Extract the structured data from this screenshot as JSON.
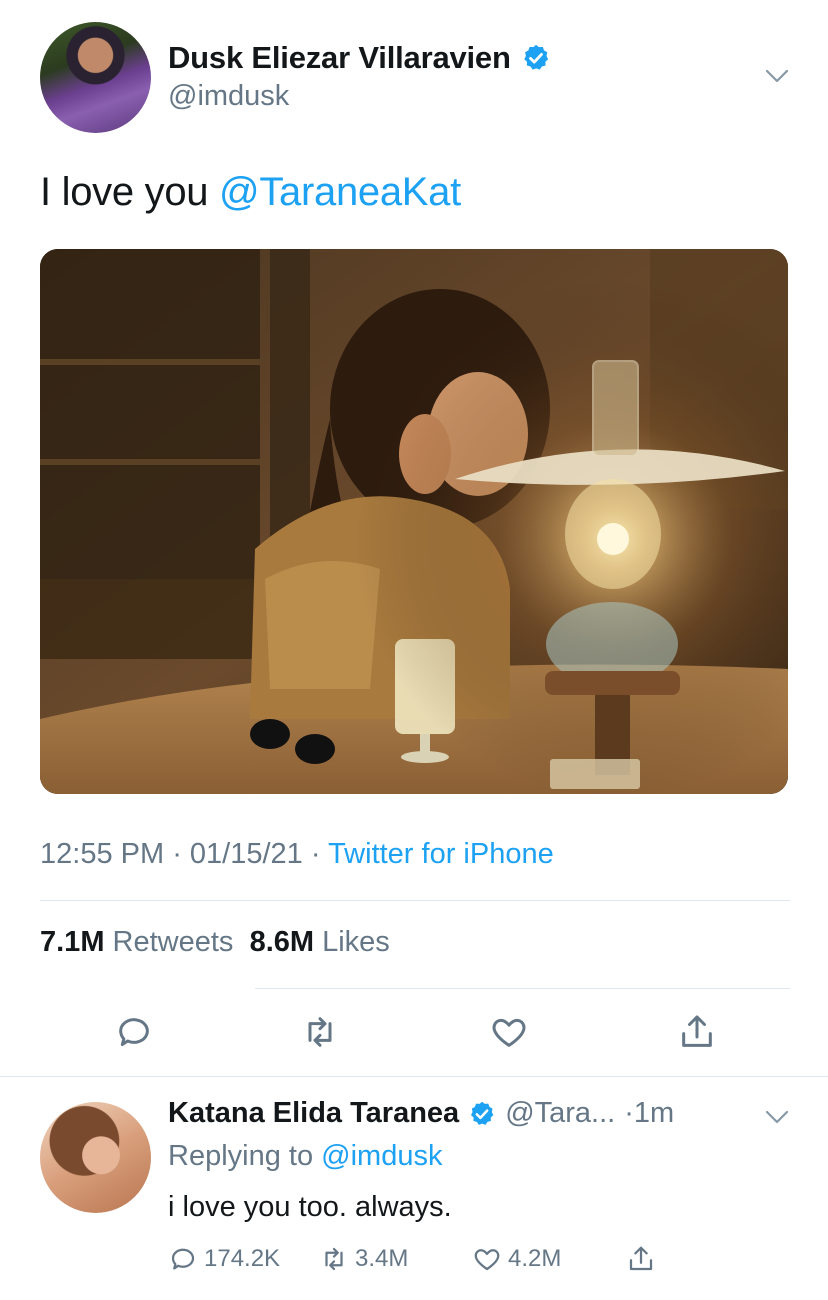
{
  "tweet": {
    "display_name": "Dusk Eliezar Villaravien",
    "handle": "@imdusk",
    "text_prefix": "I love you ",
    "mention": "@TaraneaKat",
    "time": "12:55 PM",
    "separator": " · ",
    "date": "01/15/21",
    "source": "Twitter for iPhone",
    "retweets_count": "7.1M",
    "retweets_label": " Retweets",
    "likes_count": "8.6M",
    "likes_label": " Likes",
    "icons": {
      "verified": "verified-badge-icon",
      "more": "chevron-down-icon",
      "reply": "comment-icon",
      "retweet": "retweet-icon",
      "like": "heart-icon",
      "share": "share-icon"
    }
  },
  "reply": {
    "display_name": "Katana Elida Taranea",
    "handle": "@Tara...",
    "time": "·1m",
    "replying_prefix": "Replying to ",
    "replying_to": "@imdusk",
    "text": "i love you too. always.",
    "reply_count": "174.2K",
    "retweet_count": "3.4M",
    "like_count": "4.2M"
  },
  "colors": {
    "accent": "#1da1f2",
    "secondary_text": "#657786",
    "primary_text": "#14171a",
    "divider": "#e1e8ed"
  }
}
